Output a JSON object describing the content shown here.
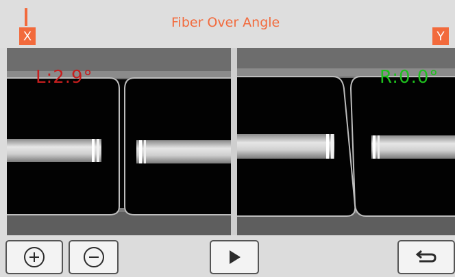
{
  "header": {
    "title": "Fiber Over Angle",
    "left_camera_label": "X",
    "right_camera_label": "Y",
    "accent_color": "#f26a3c"
  },
  "views": {
    "left": {
      "angle_text": "L:2.9°",
      "text_color": "#c61e1e"
    },
    "right": {
      "angle_text": "R:0.0°",
      "text_color": "#1ec11e"
    }
  },
  "toolbar": {
    "zoom_in_icon": "zoom-in-plus-icon",
    "zoom_out_icon": "zoom-out-minus-icon",
    "play_icon": "play-icon",
    "back_icon": "return-back-icon"
  }
}
